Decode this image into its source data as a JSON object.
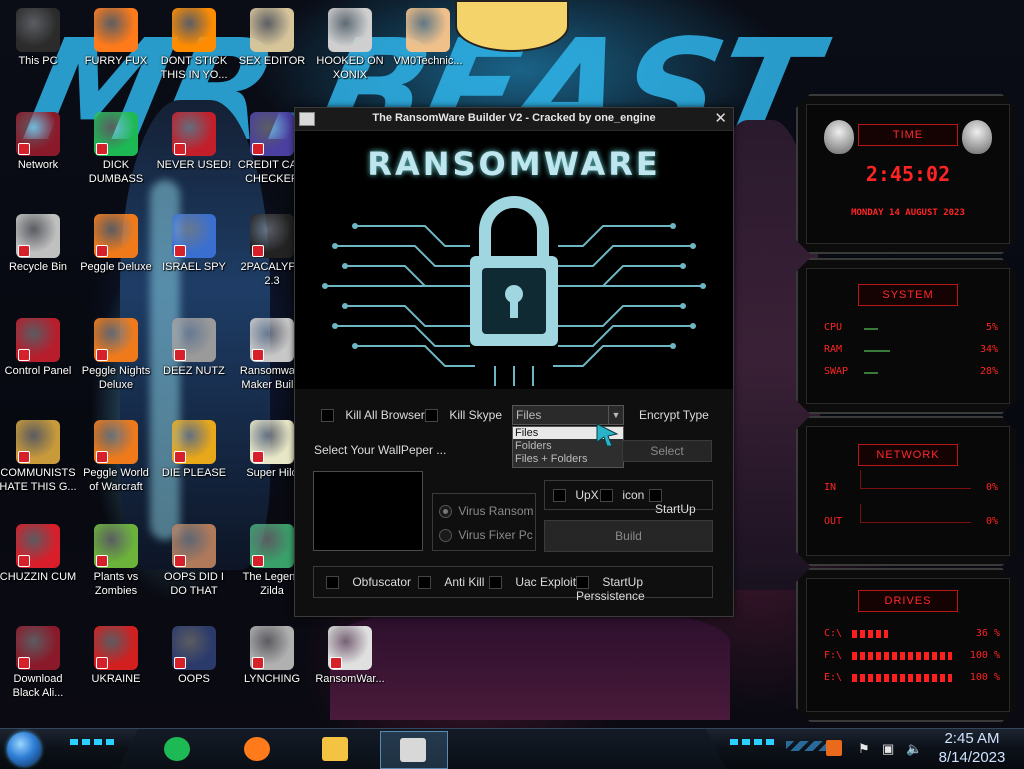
{
  "desktop_icons": [
    {
      "id": "this-pc",
      "label": "This PC",
      "color": "#2b2b2b"
    },
    {
      "id": "furry-fux",
      "label": "FURRY FUX",
      "color": "#ff7a1a"
    },
    {
      "id": "dont-stick",
      "label": "DONT STICK THIS IN YO...",
      "color": "#ff8c00"
    },
    {
      "id": "sex-editor",
      "label": "SEX EDITOR",
      "color": "#d7c59a"
    },
    {
      "id": "hooked-on-xonix",
      "label": "HOOKED ON XONIX",
      "color": "#cfcfcf"
    },
    {
      "id": "vm0technic",
      "label": "VM0Technic...",
      "color": "#f0c08a"
    },
    {
      "id": "network",
      "label": "Network",
      "color": "#8a1a2a"
    },
    {
      "id": "dick-dumbass",
      "label": "DICK DUMBASS",
      "color": "#1db954"
    },
    {
      "id": "never-used",
      "label": "NEVER USED!",
      "color": "#c21f2b"
    },
    {
      "id": "credit-card-checker",
      "label": "CREDIT CA... CHECKER",
      "color": "#4b3fa0"
    },
    {
      "id": "recycle-bin",
      "label": "Recycle Bin",
      "color": "#c0c0c0"
    },
    {
      "id": "peggle-deluxe",
      "label": "Peggle Deluxe",
      "color": "#f07a1a"
    },
    {
      "id": "israel-spy",
      "label": "ISRAEL SPY",
      "color": "#3a6fd0"
    },
    {
      "id": "2pacalypse",
      "label": "2PACALYP... 2.3",
      "color": "#222222"
    },
    {
      "id": "control-panel",
      "label": "Control Panel",
      "color": "#b81d2c"
    },
    {
      "id": "peggle-nights",
      "label": "Peggle Nights Deluxe",
      "color": "#f07a1a"
    },
    {
      "id": "deez-nutz",
      "label": "DEEZ NUTZ",
      "color": "#9a9a9a"
    },
    {
      "id": "ransomware-maker",
      "label": "Ransomwa... Maker Buil...",
      "color": "#c8c8c8"
    },
    {
      "id": "communists",
      "label": "COMMUNISTS HATE THIS G...",
      "color": "#c89a3a"
    },
    {
      "id": "peggle-wow",
      "label": "Peggle World of Warcraft",
      "color": "#f07a1a"
    },
    {
      "id": "die-please",
      "label": "DIE PLEASE",
      "color": "#e8a81a"
    },
    {
      "id": "super-hilo",
      "label": "Super Hilo",
      "color": "#e8e8c8"
    },
    {
      "id": "chuzzin-cum",
      "label": "CHUZZIN CUM",
      "color": "#d81e2a"
    },
    {
      "id": "plants-zombies",
      "label": "Plants vs Zombies",
      "color": "#6bb33a"
    },
    {
      "id": "oops-did-i",
      "label": "OOPS DID I DO THAT",
      "color": "#b07a5a"
    },
    {
      "id": "legend-zilda",
      "label": "The Legend Zilda",
      "color": "#3aa06a"
    },
    {
      "id": "download-black-ali",
      "label": "Download Black Ali...",
      "color": "#8a1a2a"
    },
    {
      "id": "ukraine",
      "label": "UKRAINE",
      "color": "#d21f1f"
    },
    {
      "id": "oops",
      "label": "OOPS",
      "color": "#2a3a6a"
    },
    {
      "id": "lynching",
      "label": "LYNCHING",
      "color": "#b0b0b0"
    },
    {
      "id": "ransomwar-skull",
      "label": "RansomWar...",
      "color": "#e0e0e0"
    }
  ],
  "window": {
    "title": "The RansomWare Builder V2 - Cracked by one_engine",
    "close_glyph": "✕",
    "banner_text": "RANSOMWARE",
    "kill_all_browser": "Kill All Browser",
    "kill_skype": "Kill Skype",
    "encrypt_select_value": "Files",
    "encrypt_options": [
      "Files",
      "Folders",
      "Files + Folders"
    ],
    "encrypt_type_label": "Encrypt Type",
    "wallpaper_label": "Select Your WallPeper ...",
    "select_button": "Select",
    "virus_ransom": "Virus Ransom",
    "virus_fixer": "Virus Fixer Pc",
    "upx": "UpX",
    "icon": "icon",
    "startup": "StartUp",
    "build_button": "Build",
    "obfuscator": "Obfuscator",
    "anti_kill": "Anti Kill",
    "uac_exploit": "Uac Exploit",
    "startup_persistence": "StartUp Perssistence"
  },
  "gadget_time": {
    "title": "TIME",
    "time": "2:45:02",
    "date": "MONDAY 14 AUGUST 2023"
  },
  "gadget_system": {
    "title": "SYSTEM",
    "rows": [
      {
        "label": "CPU",
        "value": "5%"
      },
      {
        "label": "RAM",
        "value": "34%"
      },
      {
        "label": "SWAP",
        "value": "28%"
      }
    ]
  },
  "gadget_network": {
    "title": "NETWORK",
    "rows": [
      {
        "label": "IN",
        "value": "0%"
      },
      {
        "label": "OUT",
        "value": "0%"
      }
    ]
  },
  "gadget_drives": {
    "title": "DRIVES",
    "rows": [
      {
        "label": "C:\\",
        "value": "36 %",
        "fill": 0.36
      },
      {
        "label": "F:\\",
        "value": "100 %",
        "fill": 1.0
      },
      {
        "label": "E:\\",
        "value": "100 %",
        "fill": 1.0
      }
    ]
  },
  "wallpaper_text": "MR.BEAST",
  "taskbar": {
    "apps": [
      {
        "id": "spotify",
        "color": "#1db954"
      },
      {
        "id": "firefox",
        "color": "#ff7a1a"
      },
      {
        "id": "explorer",
        "color": "#f5c342"
      },
      {
        "id": "ransomware-builder",
        "color": "#d8d8d8"
      }
    ],
    "clock_time": "2:45 AM",
    "clock_date": "8/14/2023"
  }
}
